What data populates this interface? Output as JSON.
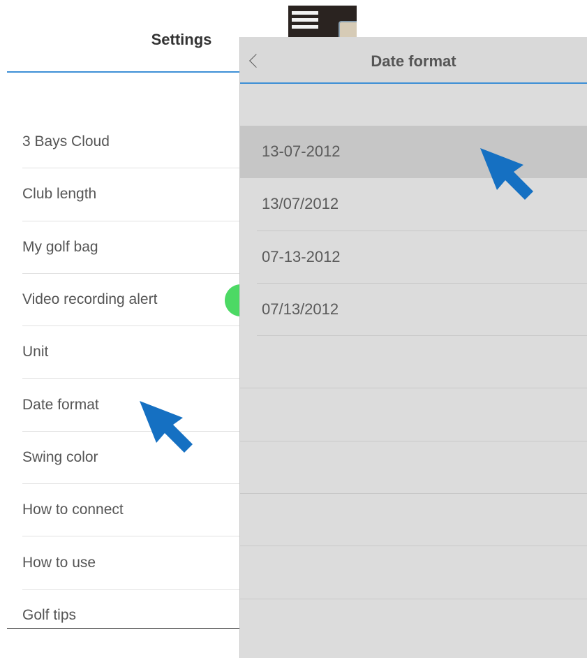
{
  "settings": {
    "title": "Settings",
    "items": [
      {
        "label": "3 Bays Cloud"
      },
      {
        "label": "Club length"
      },
      {
        "label": "My golf bag"
      },
      {
        "label": "Video recording alert"
      },
      {
        "label": "Unit"
      },
      {
        "label": "Date format"
      },
      {
        "label": "Swing color"
      },
      {
        "label": "How to connect"
      },
      {
        "label": "How to use"
      },
      {
        "label": "Golf tips"
      }
    ],
    "video_recording_alert_toggle": "on"
  },
  "date_format": {
    "title": "Date format",
    "options": [
      {
        "label": "13-07-2012",
        "selected": true
      },
      {
        "label": "13/07/2012",
        "selected": false
      },
      {
        "label": "07-13-2012",
        "selected": false
      },
      {
        "label": "07/13/2012",
        "selected": false
      }
    ]
  },
  "colors": {
    "accent_line": "#3d8fd6",
    "pointer_arrow": "#1570c2",
    "toggle_on": "#4cd964",
    "panel_bg": "#dcdcdc",
    "selected_row": "#c6c6c6"
  }
}
